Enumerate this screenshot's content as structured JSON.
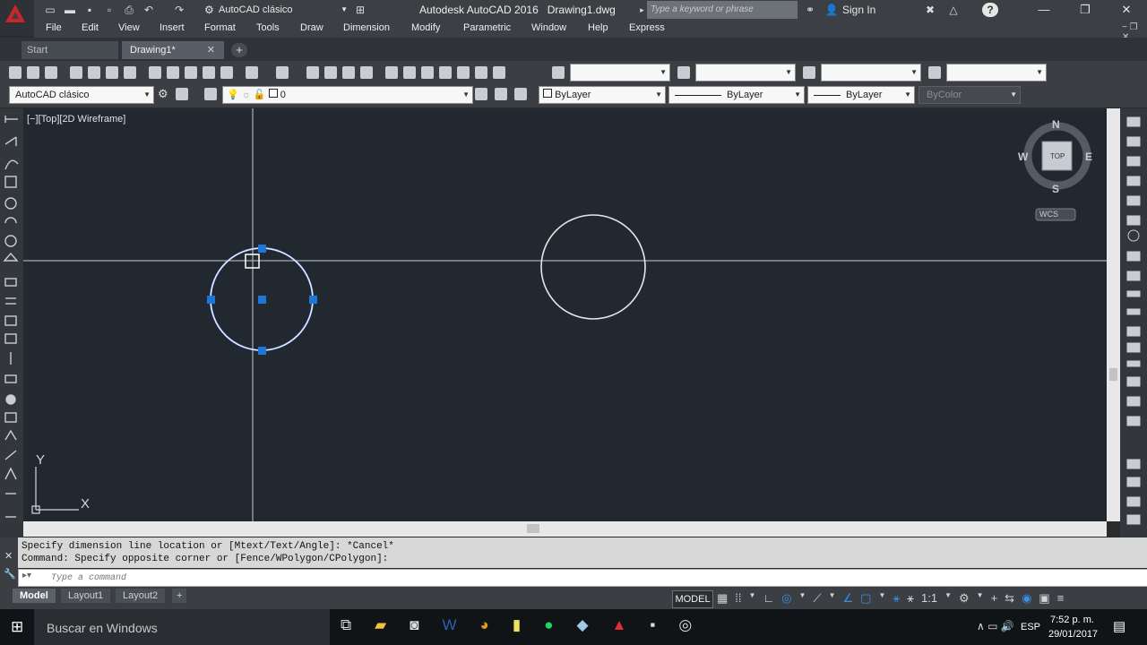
{
  "app": {
    "title": "Autodesk AutoCAD 2016   Drawing1.dwg",
    "workspace": "AutoCAD clásico",
    "search_placeholder": "Type a keyword or phrase",
    "sign_in": "Sign In",
    "help": "?",
    "logo_icon": "autocad-logo-icon",
    "brand_color": "#c8262b"
  },
  "menus": [
    "File",
    "Edit",
    "View",
    "Insert",
    "Format",
    "Tools",
    "Draw",
    "Dimension",
    "Modify",
    "Parametric",
    "Window",
    "Help",
    "Express"
  ],
  "tabs": {
    "start": "Start",
    "drawing": "Drawing1*",
    "new": "+"
  },
  "toolbar2": {
    "workspace": "AutoCAD clásico",
    "layer": "0",
    "color": "ByLayer",
    "linetype": "ByLayer",
    "lineweight": "ByLayer",
    "plotstyle": "ByColor"
  },
  "viewport": {
    "label": "[−][Top][2D Wireframe]",
    "compass": {
      "n": "N",
      "s": "S",
      "e": "E",
      "w": "W",
      "cube": "TOP"
    },
    "wcs": "WCS",
    "ucs": {
      "x": "X",
      "y": "Y"
    }
  },
  "command": {
    "history": [
      "Specify dimension line location or [Mtext/Text/Angle]: *Cancel*",
      "Command: Specify opposite corner or [Fence/WPolygon/CPolygon]:"
    ],
    "placeholder": "Type a command"
  },
  "layout_tabs": [
    "Model",
    "Layout1",
    "Layout2",
    "+"
  ],
  "status": {
    "model": "MODEL",
    "scale": "1:1"
  },
  "taskbar": {
    "search": "Buscar en Windows",
    "lang": "ESP",
    "time": "7:52 p. m.",
    "date": "29/01/2017"
  }
}
